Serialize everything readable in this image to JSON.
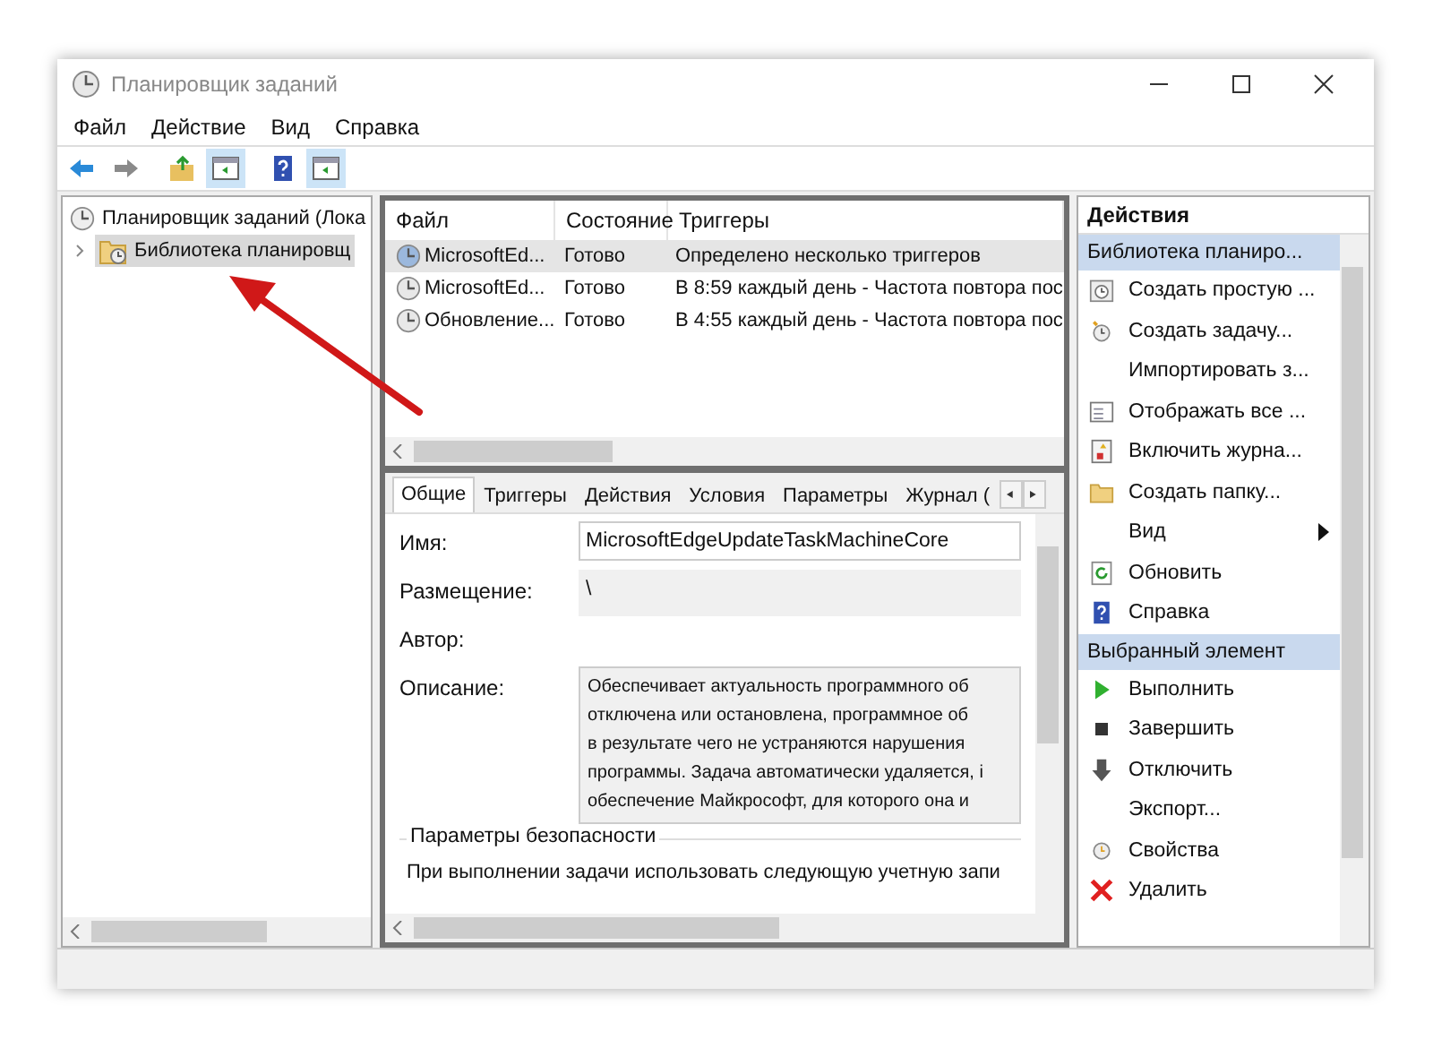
{
  "window": {
    "title": "Планировщик заданий"
  },
  "menu": [
    "Файл",
    "Действие",
    "Вид",
    "Справка"
  ],
  "toolbar": [
    {
      "pressed": false
    },
    {
      "pressed": false
    },
    {
      "pressed": false
    },
    {
      "pressed": true
    },
    {
      "pressed": false
    },
    {
      "pressed": true
    }
  ],
  "tree": [
    {
      "label": "Планировщик заданий (Лока",
      "selected": false,
      "children": [
        {
          "label": "Библиотека планировщ",
          "selected": true,
          "expanded": false
        }
      ]
    }
  ],
  "task_list": {
    "columns": [
      "Файл",
      "Состояние",
      "Триггеры"
    ],
    "rows": [
      {
        "name": "MicrosoftEd...",
        "status": "Готово",
        "triggers": "Определено несколько триггеров",
        "selected": true
      },
      {
        "name": "MicrosoftEd...",
        "status": "Готово",
        "triggers": "В 8:59 каждый день - Частота повтора пос",
        "selected": false
      },
      {
        "name": "Обновление...",
        "status": "Готово",
        "triggers": "В 4:55 каждый день - Частота повтора пос",
        "selected": false
      }
    ]
  },
  "details": {
    "tabs": [
      {
        "label": "Общие",
        "selected": true
      },
      {
        "label": "Триггеры",
        "selected": false
      },
      {
        "label": "Действия",
        "selected": false
      },
      {
        "label": "Условия",
        "selected": false
      },
      {
        "label": "Параметры",
        "selected": false
      },
      {
        "label": "Журнал (",
        "selected": false
      }
    ],
    "name_label": "Имя:",
    "name_value": "MicrosoftEdgeUpdateTaskMachineCore",
    "location_label": "Размещение:",
    "location_value": "\\",
    "author_label": "Автор:",
    "description_label": "Описание:",
    "description_lines": [
      "Обеспечивает актуальность программного об",
      "отключена или остановлена, программное об",
      "в результате чего не устраняются нарушения",
      "программы. Задача автоматически удаляется, і",
      "обеспечение Майкрософт, для которого она и"
    ],
    "security_title": "Параметры безопасности",
    "security_text": "При выполнении задачи использовать следующую учетную запи"
  },
  "actions": {
    "title": "Действия",
    "groups": [
      {
        "title": "Библиотека планиро...",
        "items": [
          {
            "label": "Создать простую ..."
          },
          {
            "label": "Создать задачу..."
          },
          {
            "label": "Импортировать з..."
          },
          {
            "label": "Отображать все ..."
          },
          {
            "label": "Включить журна..."
          },
          {
            "label": "Создать папку..."
          },
          {
            "label": "Вид",
            "submenu": true
          },
          {
            "label": "Обновить"
          },
          {
            "label": "Справка"
          }
        ]
      },
      {
        "title": "Выбранный элемент",
        "items": [
          {
            "label": "Выполнить"
          },
          {
            "label": "Завершить"
          },
          {
            "label": "Отключить"
          },
          {
            "label": "Экспорт..."
          },
          {
            "label": "Свойства"
          },
          {
            "label": "Удалить"
          }
        ]
      }
    ]
  }
}
